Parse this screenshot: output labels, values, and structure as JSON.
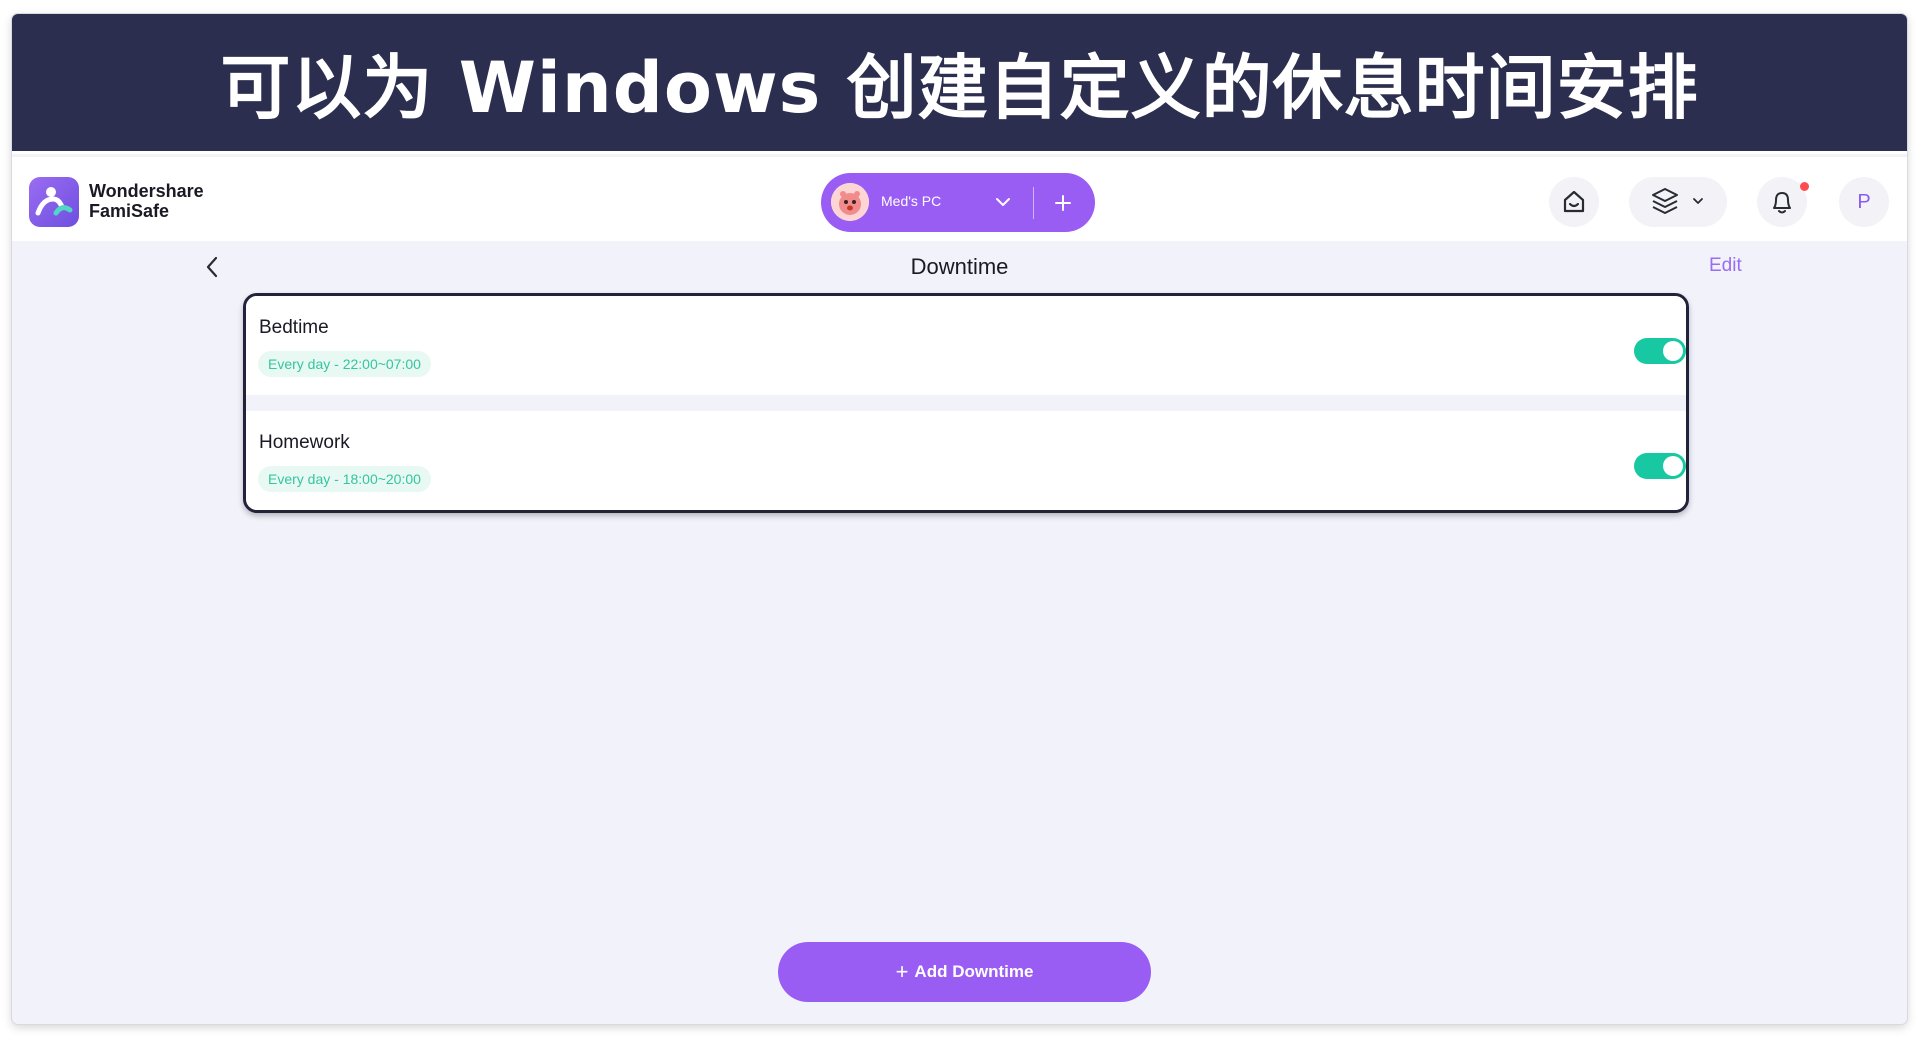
{
  "banner": {
    "title": "可以为 Windows 创建自定义的休息时间安排"
  },
  "app": {
    "logo_icon": "famisafe-logo-icon",
    "brand_line1": "Wondershare",
    "brand_line2": "FamiSafe"
  },
  "device_selector": {
    "device_name": "Med's PC",
    "avatar_icon": "child-avatar-icon",
    "chevron_icon": "chevron-down-icon",
    "add_icon": "plus-icon"
  },
  "header_actions": {
    "home_icon": "home-icon",
    "layers_icon": "layers-icon",
    "bell_icon": "bell-icon",
    "profile_letter": "P"
  },
  "page": {
    "back_icon": "chevron-left-icon",
    "title": "Downtime",
    "edit_label": "Edit"
  },
  "downtimes": [
    {
      "name": "Bedtime",
      "schedule": "Every day - 22:00~07:00",
      "enabled": true
    },
    {
      "name": "Homework",
      "schedule": "Every day - 18:00~20:00",
      "enabled": true
    }
  ],
  "add_button": {
    "plus": "+",
    "label": "Add Downtime"
  },
  "colors": {
    "banner_bg": "#2b2e4f",
    "accent_purple": "#9a5df4",
    "toggle_on": "#17c8a2",
    "schedule_text": "#35c5a0",
    "page_bg": "#f2f2fb"
  }
}
